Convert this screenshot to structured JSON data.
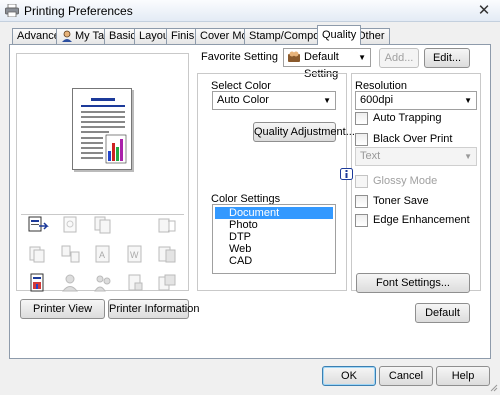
{
  "window": {
    "title": "Printing Preferences",
    "close_glyph": "✕"
  },
  "tabs": [
    {
      "label": "Advanced"
    },
    {
      "label": "My Tab"
    },
    {
      "label": "Basic"
    },
    {
      "label": "Layout"
    },
    {
      "label": "Finish"
    },
    {
      "label": "Cover Mode"
    },
    {
      "label": "Stamp/Composition"
    },
    {
      "label": "Quality",
      "active": true
    },
    {
      "label": "Other"
    }
  ],
  "favorite": {
    "label": "Favorite Setting",
    "value": "Default Setting",
    "add_label": "Add...",
    "edit_label": "Edit..."
  },
  "select_color": {
    "label": "Select Color",
    "value": "Auto Color"
  },
  "quality_adjustment_label": "Quality Adjustment...",
  "color_settings": {
    "label": "Color Settings",
    "items": [
      "Document",
      "Photo",
      "DTP",
      "Web",
      "CAD"
    ],
    "selected": "Document"
  },
  "resolution": {
    "label": "Resolution",
    "value": "600dpi"
  },
  "options": {
    "auto_trapping": "Auto Trapping",
    "black_over_print": "Black Over Print",
    "black_over_print_value": "Text",
    "glossy_mode": "Glossy Mode",
    "toner_save": "Toner Save",
    "edge_enhancement": "Edge Enhancement"
  },
  "font_settings_label": "Font Settings...",
  "default_label": "Default",
  "printer_view_label": "Printer View",
  "printer_information_label": "Printer Information",
  "footer": {
    "ok": "OK",
    "cancel": "Cancel",
    "help": "Help"
  },
  "colors": {
    "selection": "#3399ff",
    "accent_blue": "#1c3a9a",
    "dialog_bg": "#f0f0f0"
  }
}
